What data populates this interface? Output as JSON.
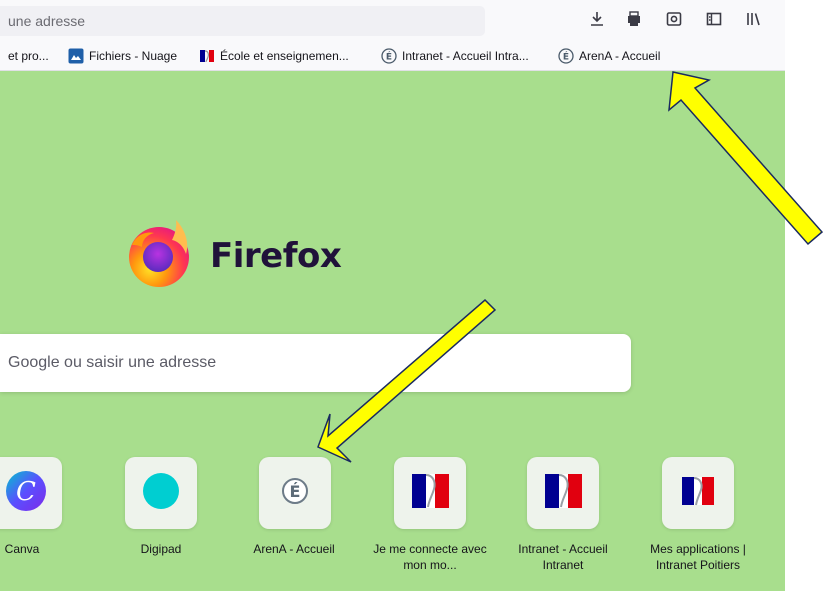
{
  "toolbar": {
    "url_placeholder": "une adresse",
    "icons": [
      "download-icon",
      "print-icon",
      "screenshot-icon",
      "reader-icon",
      "library-icon"
    ]
  },
  "bookmarks": [
    {
      "label": "et pro...",
      "icon": "folder-icon"
    },
    {
      "label": "Fichiers - Nuage",
      "icon": "nuage-icon"
    },
    {
      "label": "École et enseignemen...",
      "icon": "marianne-icon"
    },
    {
      "label": "Intranet - Accueil Intra...",
      "icon": "education-e-icon"
    },
    {
      "label": "ArenA - Accueil",
      "icon": "education-e-icon"
    }
  ],
  "newtab": {
    "brand": "Firefox",
    "search_placeholder": "Google ou saisir une adresse",
    "background": "#a8de8d",
    "shortcuts": [
      {
        "label": "Canva",
        "icon": "canva-icon"
      },
      {
        "label": "Digipad",
        "icon": "digipad-icon"
      },
      {
        "label": "ArenA - Accueil",
        "icon": "education-e-icon"
      },
      {
        "label": "Je me connecte avec mon mo...",
        "icon": "marianne-icon"
      },
      {
        "label": "Intranet - Accueil Intranet",
        "icon": "marianne-icon"
      },
      {
        "label": "Mes applications | Intranet Poitiers",
        "icon": "marianne-icon"
      }
    ]
  },
  "annotations": {
    "arrow_color": "#ffff00",
    "count": 2
  }
}
